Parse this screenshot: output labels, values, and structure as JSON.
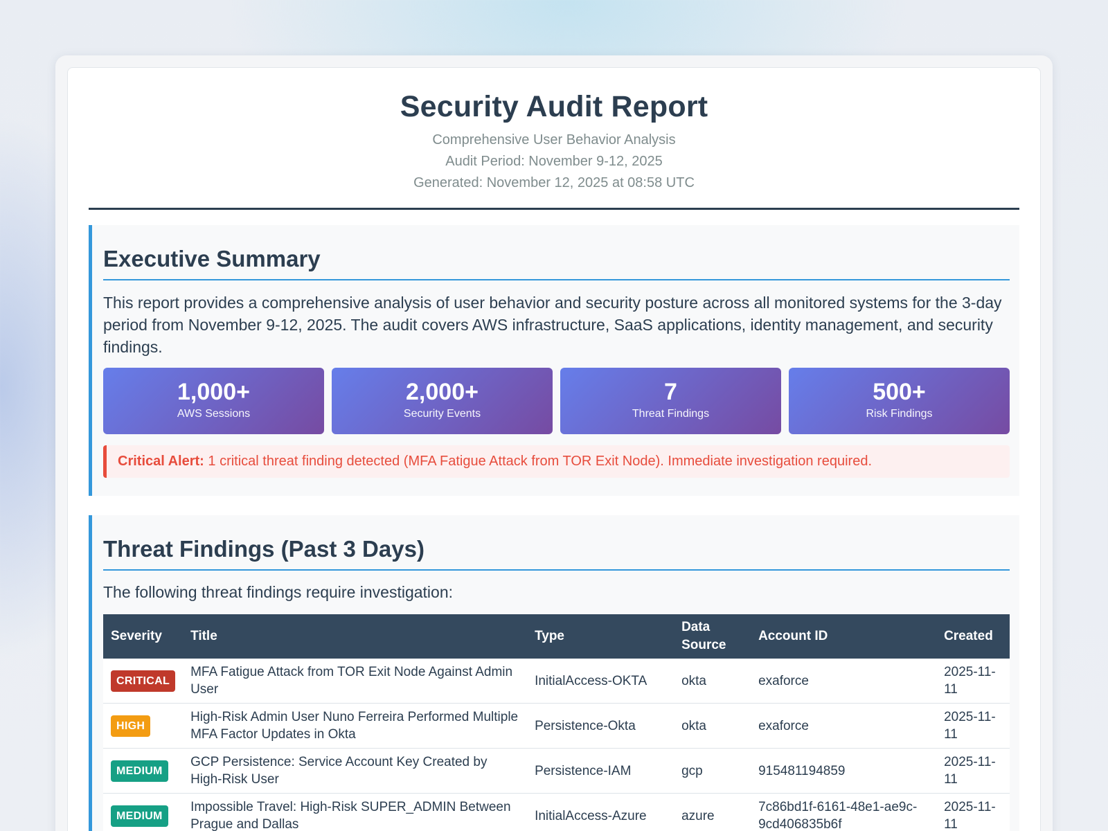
{
  "report": {
    "title": "Security Audit Report",
    "subtitle": "Comprehensive User Behavior Analysis",
    "audit_period": "Audit Period: November 9-12, 2025",
    "generated": "Generated: November 12, 2025 at 08:58 UTC"
  },
  "executive_summary": {
    "heading": "Executive Summary",
    "text": "This report provides a comprehensive analysis of user behavior and security posture across all monitored systems for the 3-day period from November 9-12, 2025. The audit covers AWS infrastructure, SaaS applications, identity management, and security findings.",
    "stats": [
      {
        "value": "1,000+",
        "label": "AWS Sessions"
      },
      {
        "value": "2,000+",
        "label": "Security Events"
      },
      {
        "value": "7",
        "label": "Threat Findings"
      },
      {
        "value": "500+",
        "label": "Risk Findings"
      }
    ],
    "alert": {
      "label": "Critical Alert:",
      "text": " 1 critical threat finding detected (MFA Fatigue Attack from TOR Exit Node). Immediate investigation required."
    }
  },
  "threat_findings": {
    "heading": "Threat Findings (Past 3 Days)",
    "intro": "The following threat findings require investigation:",
    "columns": {
      "severity": "Severity",
      "title": "Title",
      "type": "Type",
      "data_source": "Data Source",
      "account_id": "Account ID",
      "created": "Created"
    },
    "rows": [
      {
        "severity": "CRITICAL",
        "title": "MFA Fatigue Attack from TOR Exit Node Against Admin User",
        "type": "InitialAccess-OKTA",
        "data_source": "okta",
        "account_id": "exaforce",
        "created": "2025-11-11"
      },
      {
        "severity": "HIGH",
        "title": "High-Risk Admin User Nuno Ferreira Performed Multiple MFA Factor Updates in Okta",
        "type": "Persistence-Okta",
        "data_source": "okta",
        "account_id": "exaforce",
        "created": "2025-11-11"
      },
      {
        "severity": "MEDIUM",
        "title": "GCP Persistence: Service Account Key Created by High-Risk User",
        "type": "Persistence-IAM",
        "data_source": "gcp",
        "account_id": "915481194859",
        "created": "2025-11-11"
      },
      {
        "severity": "MEDIUM",
        "title": "Impossible Travel: High-Risk SUPER_ADMIN Between Prague and Dallas",
        "type": "InitialAccess-Azure",
        "data_source": "azure",
        "account_id": "7c86bd1f-6161-48e1-ae9c-9cd406835b6f",
        "created": "2025-11-11"
      }
    ]
  },
  "colors": {
    "heading": "#2c3e50",
    "accent_blue": "#3498db",
    "table_header": "#34495e",
    "stat_gradient_start": "#667eea",
    "stat_gradient_end": "#764ba2",
    "alert_red": "#e74c3c",
    "critical": "#c0392b",
    "high": "#f39c12",
    "medium": "#16a085"
  }
}
